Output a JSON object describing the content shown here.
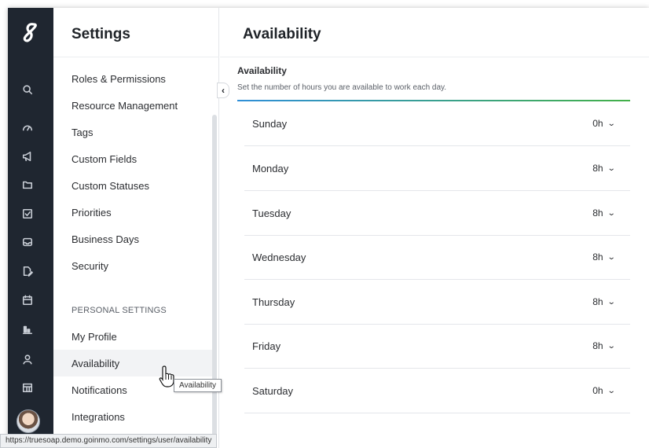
{
  "rail": {
    "icons": [
      "logo-icon",
      "search-icon",
      "dashboard-icon",
      "megaphone-icon",
      "folder-icon",
      "checkbox-icon",
      "inbox-icon",
      "edit-icon",
      "calendar-icon",
      "bar-chart-icon",
      "user-icon",
      "table-icon"
    ]
  },
  "sidebar": {
    "title": "Settings",
    "items": [
      "Roles & Permissions",
      "Resource Management",
      "Tags",
      "Custom Fields",
      "Custom Statuses",
      "Priorities",
      "Business Days",
      "Security"
    ],
    "personal_label": "PERSONAL SETTINGS",
    "personal_items": [
      "My Profile",
      "Availability",
      "Notifications",
      "Integrations"
    ]
  },
  "main": {
    "title": "Availability",
    "panel_title": "Availability",
    "panel_description": "Set the number of hours you are available to work each day.",
    "days": [
      {
        "name": "Sunday",
        "hours": "0h"
      },
      {
        "name": "Monday",
        "hours": "8h"
      },
      {
        "name": "Tuesday",
        "hours": "8h"
      },
      {
        "name": "Wednesday",
        "hours": "8h"
      },
      {
        "name": "Thursday",
        "hours": "8h"
      },
      {
        "name": "Friday",
        "hours": "8h"
      },
      {
        "name": "Saturday",
        "hours": "0h"
      }
    ]
  },
  "tooltip": "Availability",
  "status_url": "https://truesoap.demo.goinmo.com/settings/user/availability",
  "colors": {
    "rail": "#1f2630",
    "accent_start": "#2f8fd8",
    "accent_end": "#43b049"
  }
}
